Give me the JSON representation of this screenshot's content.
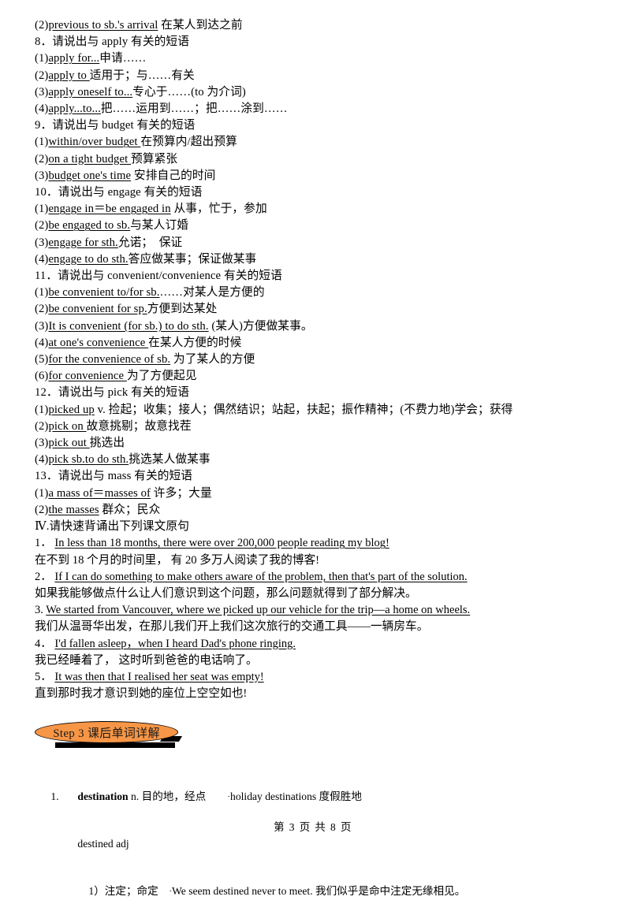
{
  "document": {
    "title": "英语复习讲义 第3页",
    "footer": "第 3 页 共 8 页"
  },
  "content": {
    "lines": [
      {
        "id": "l1",
        "number": "(2)",
        "phrase": "previous to sb.'s arrival",
        "meaning": " 在某人到达之前",
        "underline": true
      },
      {
        "id": "l2",
        "number": "8．",
        "phrase": "",
        "meaning": "请说出与 apply 有关的短语",
        "underline": false,
        "prompt": true
      },
      {
        "id": "l3",
        "number": "(1)",
        "phrase": "apply for...",
        "meaning": "申请……",
        "underline": true
      },
      {
        "id": "l4",
        "number": "(2)",
        "phrase": "apply to ",
        "meaning": "适用于；与……有关",
        "underline": true
      },
      {
        "id": "l5",
        "number": "(3)",
        "phrase": "apply oneself to...",
        "meaning": "专心于……(to 为介词)",
        "underline": true
      },
      {
        "id": "l6",
        "number": "(4)",
        "phrase": "apply...to...",
        "meaning": "把……运用到……；把……涂到……",
        "underline": true
      },
      {
        "id": "l7",
        "number": "9．",
        "phrase": "",
        "meaning": "请说出与 budget 有关的短语",
        "underline": false,
        "prompt": true
      },
      {
        "id": "l8",
        "number": "(1)",
        "phrase": "within/over budget ",
        "meaning": "在预算内/超出预算",
        "underline": true
      },
      {
        "id": "l9",
        "number": "(2)",
        "phrase": "on a tight budget ",
        "meaning": "预算紧张",
        "underline": true
      },
      {
        "id": "l10",
        "number": "(3)",
        "phrase": "budget one's time",
        "meaning": " 安排自己的时间",
        "underline": true
      },
      {
        "id": "l11",
        "number": "10．",
        "phrase": "",
        "meaning": "请说出与 engage 有关的短语",
        "underline": false,
        "prompt": true
      },
      {
        "id": "l12",
        "number": "(1)",
        "phrase": "engage in＝be engaged in",
        "meaning": " 从事，忙于，参加",
        "underline": true
      },
      {
        "id": "l13",
        "number": "(2)",
        "phrase": "be engaged to sb.",
        "meaning": "与某人订婚",
        "underline": true
      },
      {
        "id": "l14",
        "number": "(3)",
        "phrase": "engage for sth.",
        "meaning": "允诺；  保证",
        "underline": true
      },
      {
        "id": "l15",
        "number": "(4)",
        "phrase": "engage to do sth.",
        "meaning": "答应做某事；保证做某事",
        "underline": true
      },
      {
        "id": "l16",
        "number": "11．",
        "phrase": "",
        "meaning": "请说出与 convenient/convenience 有关的短语",
        "underline": false,
        "prompt": true
      },
      {
        "id": "l17",
        "number": "(1)",
        "phrase": "be convenient to/for sb.",
        "meaning": "……对某人是方便的",
        "underline": true
      },
      {
        "id": "l18",
        "number": "(2)",
        "phrase": "be convenient for sp.",
        "meaning": "方便到达某处",
        "underline": true
      },
      {
        "id": "l19",
        "number": "(3)",
        "phrase": "It is convenient (for sb.) to do sth.",
        "meaning": " (某人)方便做某事。",
        "underline": true
      },
      {
        "id": "l20",
        "number": "(4)",
        "phrase": "at one's convenience ",
        "meaning": "在某人方便的时候",
        "underline": true
      },
      {
        "id": "l21",
        "number": "(5)",
        "phrase": "for the convenience of sb.",
        "meaning": " 为了某人的方便",
        "underline": true
      },
      {
        "id": "l22",
        "number": "(6)",
        "phrase": "for convenience ",
        "meaning": "为了方便起见",
        "underline": true
      },
      {
        "id": "l23",
        "number": "12．",
        "phrase": "",
        "meaning": "请说出与 pick 有关的短语",
        "underline": false,
        "prompt": true
      },
      {
        "id": "l24",
        "number": "(1)",
        "phrase": "picked up",
        "meaning": " v. 捡起；收集；接人；偶然结识；站起，扶起；振作精神；(不费力地)学会；获得",
        "underline": true
      },
      {
        "id": "l25",
        "number": "(2)",
        "phrase": "pick on ",
        "meaning": "故意挑剔；故意找茬",
        "underline": true
      },
      {
        "id": "l26",
        "number": "(3)",
        "phrase": "pick out ",
        "meaning": "挑选出",
        "underline": true
      },
      {
        "id": "l27",
        "number": "(4)",
        "phrase": "pick sb.to do sth.",
        "meaning": "挑选某人做某事",
        "underline": true
      },
      {
        "id": "l28",
        "number": "13．",
        "phrase": "",
        "meaning": "请说出与 mass 有关的短语",
        "underline": false,
        "prompt": true
      },
      {
        "id": "l29",
        "number": "(1)",
        "phrase": "a mass of＝masses of",
        "meaning": " 许多；大量",
        "underline": true
      },
      {
        "id": "l30",
        "number": "(2)",
        "phrase": "the masses",
        "meaning": " 群众；民众",
        "underline": true
      },
      {
        "id": "l31",
        "number": "Ⅳ.",
        "phrase": "",
        "meaning": "请快速背诵出下列课文原句",
        "underline": false,
        "prompt": false
      }
    ],
    "sentences": [
      {
        "id": "s1",
        "number": "1．",
        "english": "In less than 18 months, there were over 200,000 people reading my blog!",
        "chinese": "在不到 18 个月的时间里，  有 20 多万人阅读了我的博客!"
      },
      {
        "id": "s2",
        "number": "2．",
        "english": "If I can do something to make others aware of the problem, then that's part of the solution.",
        "chinese": "如果我能够做点什么让人们意识到这个问题，那么问题就得到了部分解决。"
      },
      {
        "id": "s3",
        "number": "3.",
        "english": "We started from Vancouver, where we picked up our vehicle for the trip—a home on wheels.",
        "chinese": "我们从温哥华出发，在那儿我们开上我们这次旅行的交通工具——一辆房车。"
      },
      {
        "id": "s4",
        "number": "4．",
        "english": "I'd fallen asleep，when I heard Dad's phone ringing.",
        "chinese": "我已经睡着了，  这时听到爸爸的电话响了。"
      },
      {
        "id": "s5",
        "number": "5．",
        "english": "It was then that I realised her seat was empty!",
        "chinese": "直到那时我才意识到她的座位上空空如也!"
      }
    ]
  },
  "step_banner": {
    "label": "Step 3  课后单词详解",
    "fill_color": "#F79646",
    "border_color": "#000000",
    "text_color": "#1a1a1a"
  },
  "vocabulary": {
    "index": "1.",
    "word": "destination",
    "pos": "n.",
    "meaning": "目的地，经点",
    "example_bullet": "·",
    "example_en": "holiday destinations",
    "example_cn": " 度假胜地",
    "derived_word": "destined adj",
    "sense_number": "1）",
    "sense_meaning": "注定；命定",
    "sense_bullet": "·",
    "sense_example_en": "We seem destined never to meet.",
    "sense_example_cn": " 我们似乎是命中注定无缘相见。"
  }
}
